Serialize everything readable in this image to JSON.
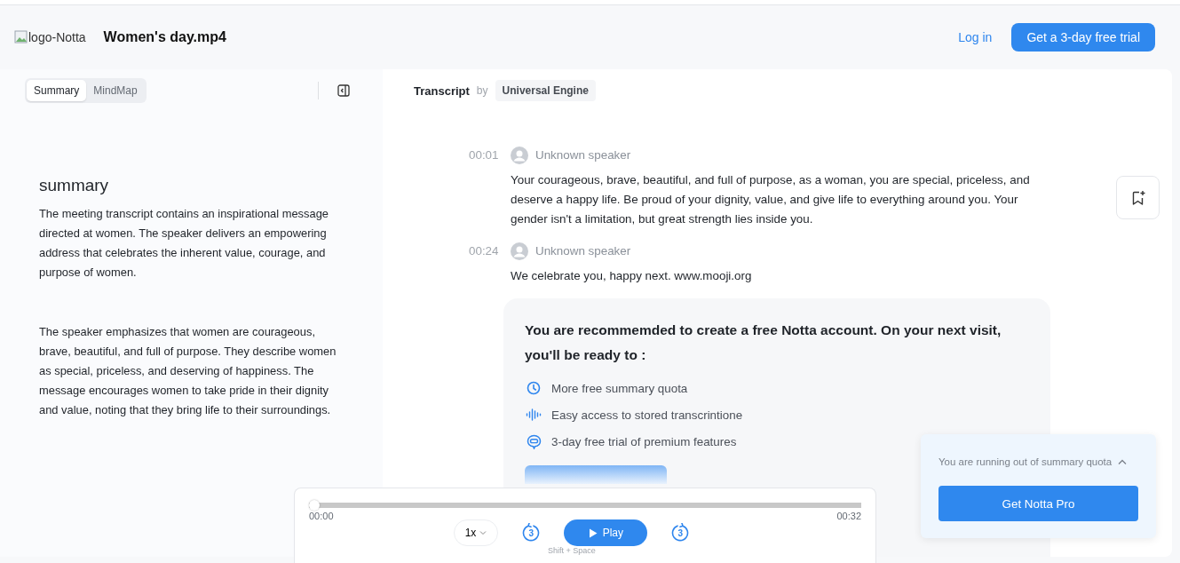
{
  "header": {
    "logo_alt": "logo-Notta",
    "file_name": "Women's day.mp4",
    "login": "Log in",
    "trial_button": "Get a 3-day free trial"
  },
  "summary_panel": {
    "tabs": [
      {
        "label": "Summary",
        "selected": true
      },
      {
        "label": "MindMap",
        "selected": false
      }
    ],
    "heading": "summary",
    "paragraphs": [
      "The meeting transcript contains an inspirational message directed at women. The speaker delivers an empowering address that celebrates the inherent value, courage, and purpose of women.",
      "The speaker emphasizes that women are courageous, brave, beautiful, and full of purpose. They describe women as special, priceless, and deserving of happiness. The message encourages women to take pride in their dignity and value, noting that they bring life to their surroundings."
    ]
  },
  "transcript": {
    "title": "Transcript",
    "by": "by",
    "engine": "Universal Engine",
    "segments": [
      {
        "time": "00:01",
        "speaker": "Unknown speaker",
        "text": "Your courageous, brave, beautiful, and full of purpose, as a woman, you are special, priceless, and deserve a happy life. Be proud of your dignity, value, and give life to everything around you. Your gender isn't a limitation, but great strength lies inside you."
      },
      {
        "time": "00:24",
        "speaker": "Unknown speaker",
        "text": "We celebrate you, happy next. www.mooji.org"
      }
    ]
  },
  "recommendation": {
    "title": "You are recommemded to create a free Notta account. On your next visit, you'll be ready to :",
    "benefits": [
      {
        "kind": "clock",
        "text": "More free summary quota"
      },
      {
        "kind": "waveform",
        "text": "Easy access to stored transcrintione"
      },
      {
        "kind": "chat",
        "text": "3-day free trial of premium features"
      }
    ]
  },
  "player": {
    "level": 0,
    "current": "00:00",
    "total": "00:32",
    "speed": "1x",
    "rewind": "3",
    "forward": "3",
    "play": "Play",
    "shortcut": "Shift + Space"
  },
  "quota_popup": {
    "message": "You are running out of summary quota",
    "expanded": true,
    "button": "Get Notta Pro"
  }
}
